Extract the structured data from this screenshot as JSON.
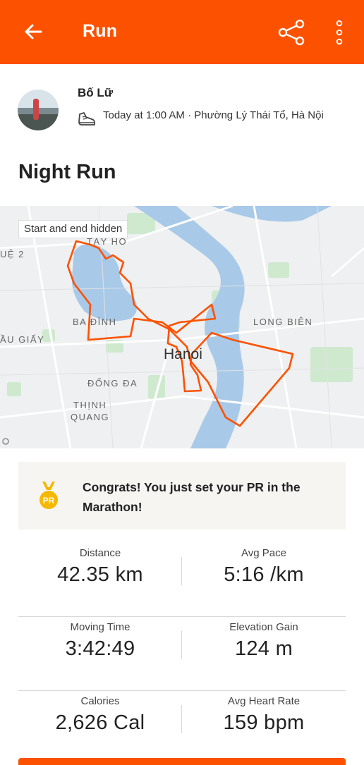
{
  "header": {
    "title": "Run",
    "back_icon": "arrow-left-icon",
    "share_icon": "share-icon",
    "more_icon": "more-vertical-icon",
    "bar_color": "#fc5200"
  },
  "athlete": {
    "name": "Bố Lữ",
    "activity_icon": "shoe-icon",
    "meta": "Today at 1:00 AM · Phường Lý Thái Tổ, Hà Nội"
  },
  "activity": {
    "title": "Night Run"
  },
  "map": {
    "privacy_label": "Start and end hidden",
    "labels": {
      "tay_ho": "TÂY HỒ",
      "ba_dinh": "BA ĐÌNH",
      "long_bien": "LONG BIÊN",
      "cau_giay": "ẦU GIẤY",
      "hanoi": "Hanoi",
      "dong_da": "ĐỐNG ĐA",
      "thinh": "THỊNH",
      "quang": "QUANG",
      "hue2": "UỆ 2"
    },
    "route_color": "#fc5200"
  },
  "achievement": {
    "icon": "pr-medal-icon",
    "badge_text": "PR",
    "text": "Congrats! You just set your PR in the Marathon!"
  },
  "stats": [
    {
      "left": {
        "label": "Distance",
        "value": "42.35 km"
      },
      "right": {
        "label": "Avg Pace",
        "value": "5:16 /km"
      }
    },
    {
      "left": {
        "label": "Moving Time",
        "value": "3:42:49"
      },
      "right": {
        "label": "Elevation Gain",
        "value": "124 m"
      }
    },
    {
      "left": {
        "label": "Calories",
        "value": "2,626 Cal"
      },
      "right": {
        "label": "Avg Heart Rate",
        "value": "159 bpm"
      }
    }
  ]
}
